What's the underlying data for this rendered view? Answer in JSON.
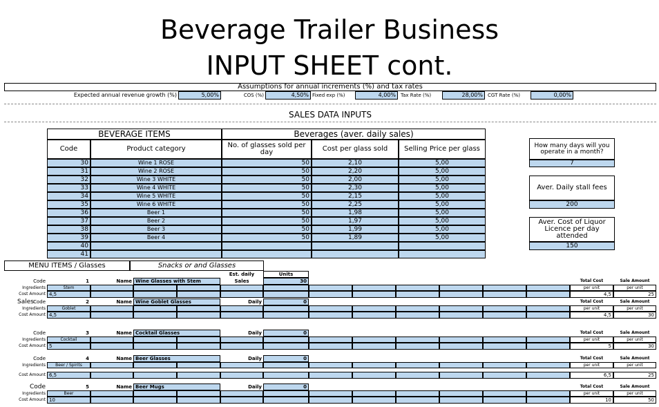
{
  "title": {
    "line1": "Beverage Trailer Business",
    "line2": "INPUT SHEET cont."
  },
  "assumptions": {
    "heading": "Assumptions for annual increments (%) and tax rates",
    "revenue_label": "Expected annual revenue growth (%)",
    "revenue_value": "5,00%",
    "cos_label": "COS (%)",
    "cos_value": "4,50%",
    "fixed_label": "Fixed exp (%)",
    "fixed_value": "4,00%",
    "tax_label": "Tax Rate (%)",
    "tax_value": "28,00%",
    "cgt_label": "CGT Rate (%)",
    "cgt_value": "0,00%"
  },
  "sales_heading": "SALES DATA INPUTS",
  "beverage_table": {
    "left_header": "BEVERAGE ITEMS",
    "right_header": "Beverages (aver. daily sales)",
    "col_code": "Code",
    "col_category": "Product category",
    "col_glasses": "No. of glasses sold per day",
    "col_cost": "Cost per glass sold",
    "col_price": "Selling Price per glass",
    "rows": [
      {
        "code": "30",
        "category": "Wine 1 ROSE",
        "glasses": "50",
        "cost": "2,10",
        "price": "5,00"
      },
      {
        "code": "31",
        "category": "Wine 2 ROSE",
        "glasses": "50",
        "cost": "2,20",
        "price": "5,00"
      },
      {
        "code": "32",
        "category": "Wine 3 WHITE",
        "glasses": "50",
        "cost": "2,00",
        "price": "5,00"
      },
      {
        "code": "33",
        "category": "Wine 4 WHITE",
        "glasses": "50",
        "cost": "2,30",
        "price": "5,00"
      },
      {
        "code": "34",
        "category": "Wine 5 WHITE",
        "glasses": "50",
        "cost": "2,15",
        "price": "5,00"
      },
      {
        "code": "35",
        "category": "Wine 6 WHITE",
        "glasses": "50",
        "cost": "2,25",
        "price": "5,00"
      },
      {
        "code": "36",
        "category": "Beer 1",
        "glasses": "50",
        "cost": "1,98",
        "price": "5,00"
      },
      {
        "code": "37",
        "category": "Beer 2",
        "glasses": "50",
        "cost": "1,97",
        "price": "5,00"
      },
      {
        "code": "38",
        "category": "Beer 3",
        "glasses": "50",
        "cost": "1,99",
        "price": "5,00"
      },
      {
        "code": "39",
        "category": "Beer 4",
        "glasses": "50",
        "cost": "1,89",
        "price": "5,00"
      },
      {
        "code": "40",
        "category": "",
        "glasses": "",
        "cost": "",
        "price": ""
      },
      {
        "code": "41",
        "category": "",
        "glasses": "",
        "cost": "",
        "price": ""
      }
    ]
  },
  "side_inputs": {
    "days_label": "How many days will you operate in a month?",
    "days_value": "7",
    "stall_label": "Aver. Daily stall fees",
    "stall_value": "200",
    "liquor_label": "Aver. Cost of Liquor Licence per day attended",
    "liquor_value": "150"
  },
  "menu": {
    "heading": "MENU ITEMS / Glasses",
    "subheading": "Snacks or and Glasses",
    "est_daily": "Est. daily",
    "units": "Units",
    "total_cost": "Total Cost",
    "sale_amount": "Sale Amount",
    "per_unit": "per unit",
    "code_label": "Code",
    "name_label": "Name",
    "ingredients_label": "Ingredients",
    "cost_amount_label": "Cost Amount",
    "sales_label": "Sales",
    "daily_label": "Daily",
    "items": [
      {
        "code": "1",
        "name": "Wine Glasses with Stem",
        "units": "30",
        "ingredient": "Stem",
        "cost": "4,5",
        "total": "4,5",
        "sale": "25"
      },
      {
        "code": "2",
        "name": "Wine Goblet Glasses",
        "units": "0",
        "ingredient": "Goblet",
        "cost": "4,5",
        "total": "4,5",
        "sale": "30"
      },
      {
        "code": "3",
        "name": "Cocktail Glasses",
        "units": "0",
        "ingredient": "Cocktail",
        "cost": "5",
        "total": "5",
        "sale": "30"
      },
      {
        "code": "4",
        "name": "Beer Glasses",
        "units": "0",
        "ingredient": "Beer / Spirits",
        "cost": "6,5",
        "total": "6,5",
        "sale": "25"
      },
      {
        "code": "5",
        "name": "Beer Mugs",
        "units": "0",
        "ingredient": "Beer",
        "cost": "10",
        "total": "10",
        "sale": "50"
      }
    ]
  }
}
